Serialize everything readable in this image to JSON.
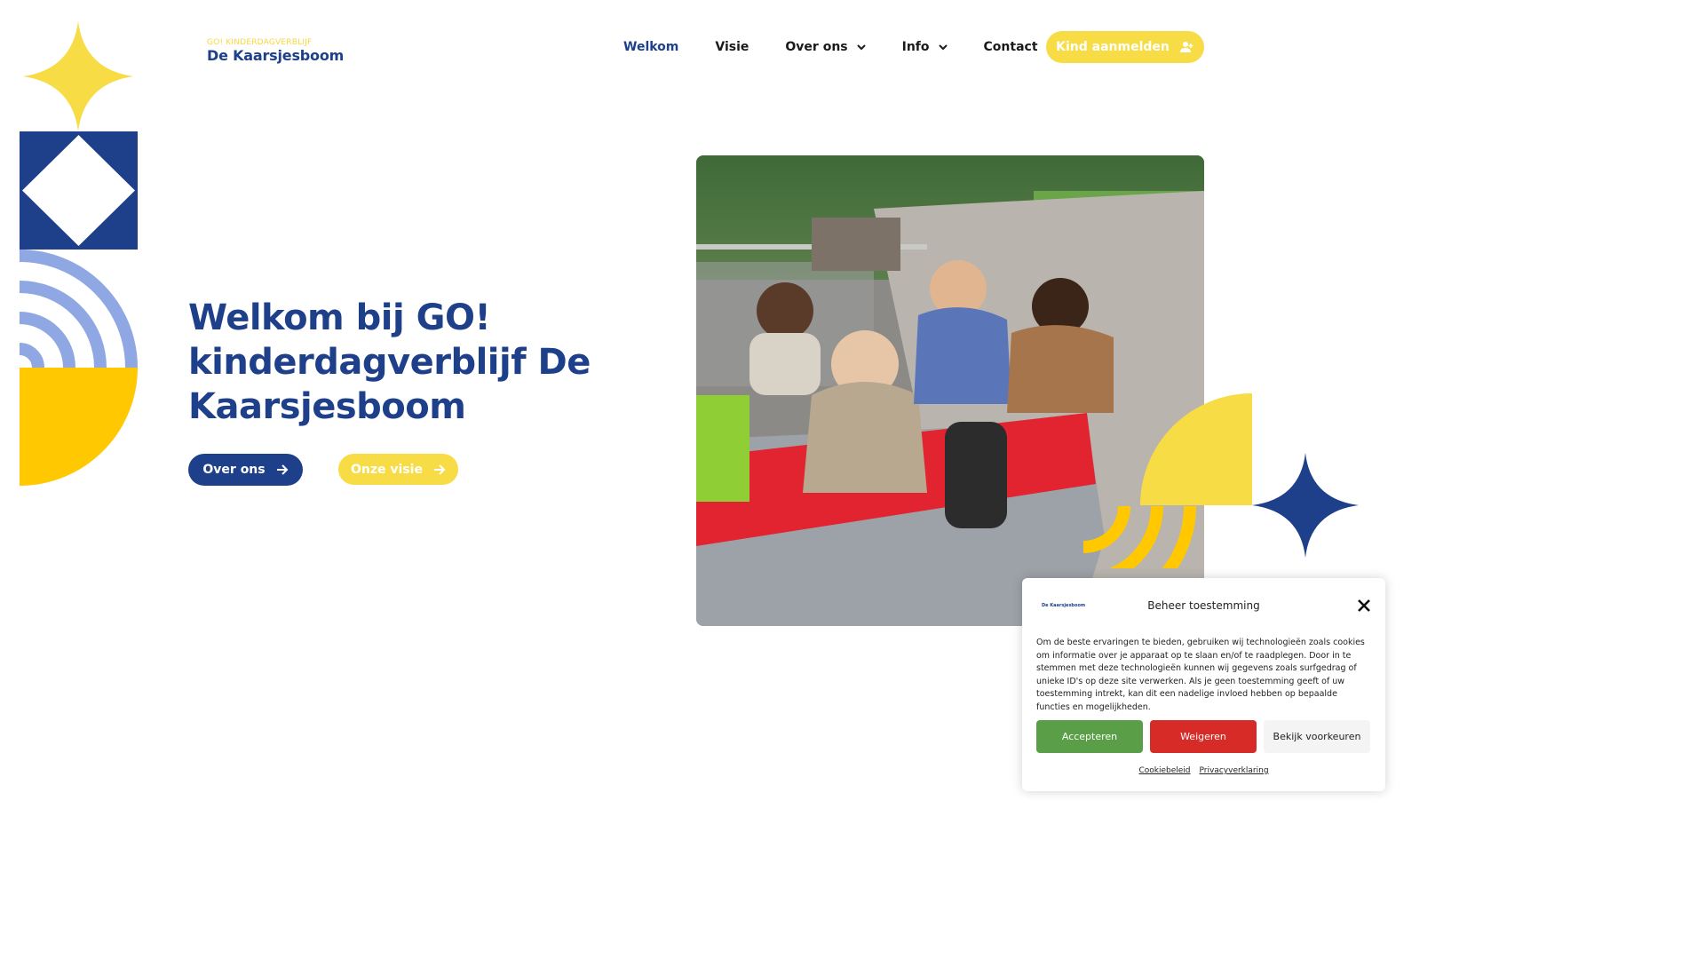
{
  "colors": {
    "brand_blue": "#1e3f8a",
    "brand_yellow": "#f7dc45",
    "deep_yellow": "#ffc800",
    "light_blue": "#8fa8e4",
    "accept_green": "#5a9e48",
    "deny_red": "#d62b26"
  },
  "logo": {
    "tagline": "GO! KINDERDAGVERBLIJF",
    "name": "De Kaarsjesboom"
  },
  "nav": {
    "items": [
      {
        "label": "Welkom",
        "active": true,
        "dropdown": false
      },
      {
        "label": "Visie",
        "active": false,
        "dropdown": false
      },
      {
        "label": "Over ons",
        "active": false,
        "dropdown": true
      },
      {
        "label": "Info",
        "active": false,
        "dropdown": true
      },
      {
        "label": "Contact",
        "active": false,
        "dropdown": false
      }
    ],
    "cta_label": "Kind aanmelden",
    "cta_icon": "user-add-icon"
  },
  "hero": {
    "title": "Welkom bij GO! kinderdagverblijf De Kaarsjesboom",
    "primary_button": "Over ons",
    "secondary_button": "Onze visie",
    "button_icon": "arrow-right-icon"
  },
  "cookie": {
    "logo_text": "De Kaarsjesboom",
    "title": "Beheer toestemming",
    "body": "Om de beste ervaringen te bieden, gebruiken wij technologieën zoals cookies om informatie over je apparaat op te slaan en/of te raadplegen. Door in te stemmen met deze technologieën kunnen wij gegevens zoals surfgedrag of unieke ID's op deze site verwerken. Als je geen toestemming geeft of uw toestemming intrekt, kan dit een nadelige invloed hebben op bepaalde functies en mogelijkheden.",
    "accept": "Accepteren",
    "deny": "Weigeren",
    "preferences": "Bekijk voorkeuren",
    "links": [
      "Cookiebeleid",
      "Privacyverklaring"
    ]
  }
}
